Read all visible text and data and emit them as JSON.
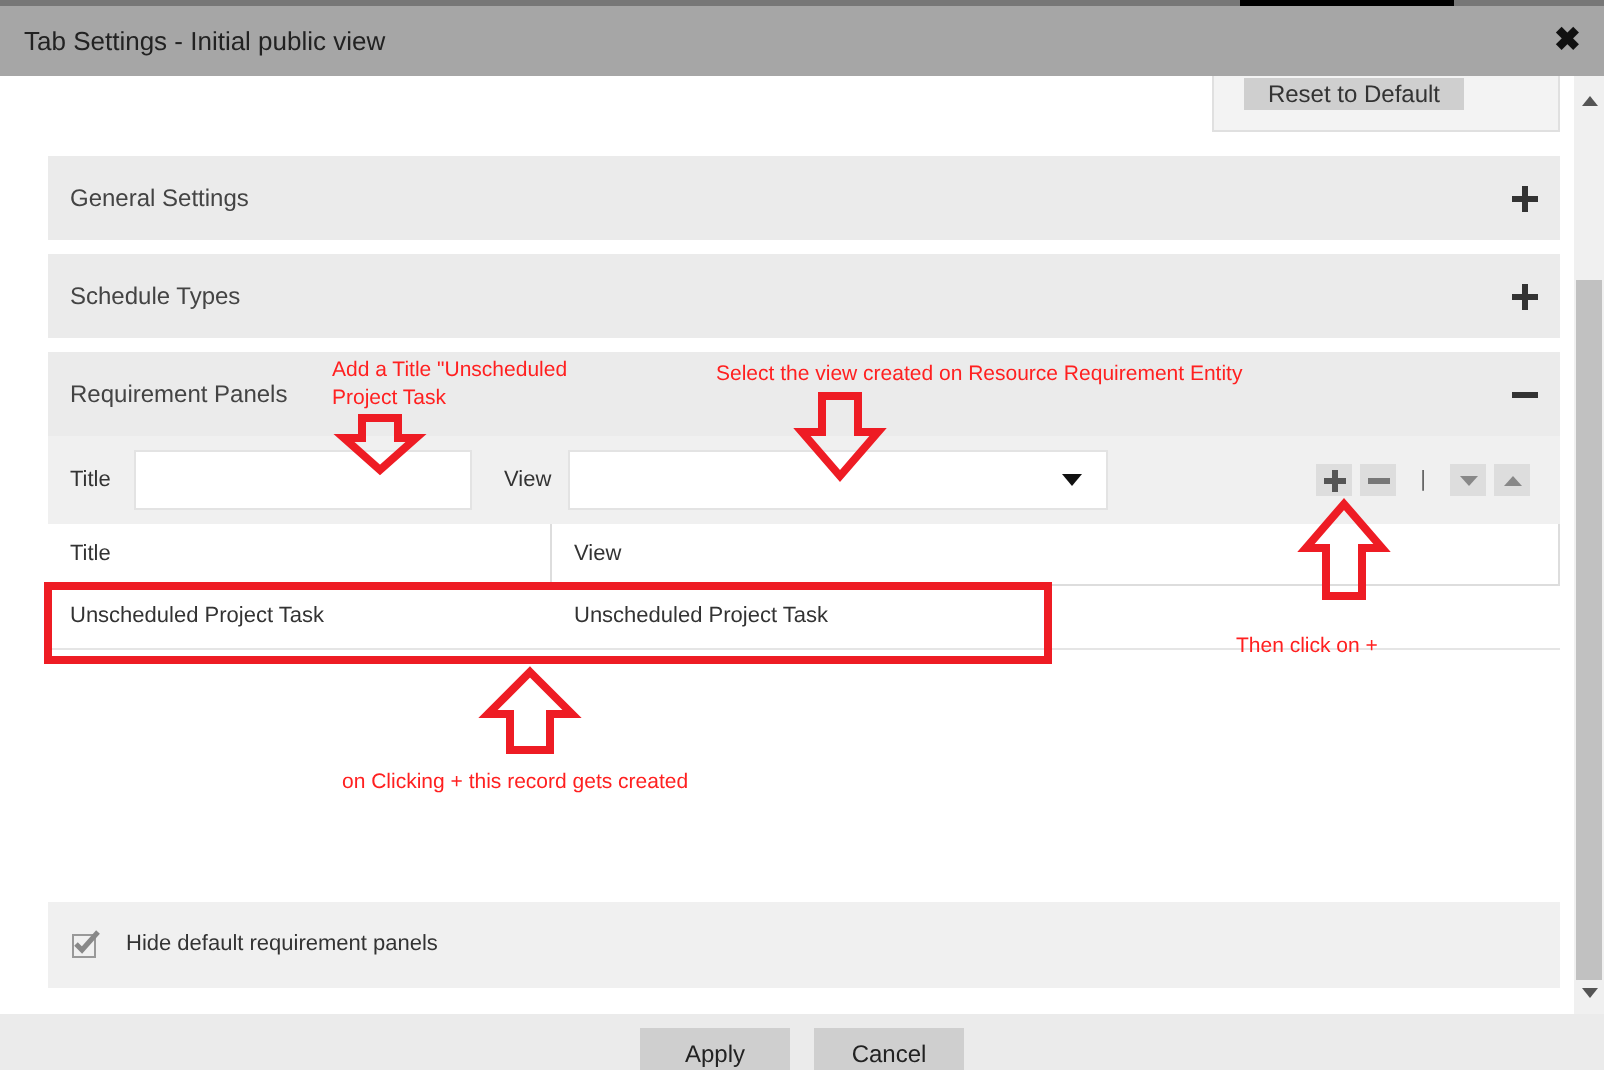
{
  "window": {
    "title": "Tab Settings - Initial public view",
    "close": "✖"
  },
  "reset_button": "Reset to Default",
  "sections": [
    {
      "title": "General Settings",
      "expanded": false
    },
    {
      "title": "Schedule Types",
      "expanded": false
    },
    {
      "title": "Requirement Panels",
      "expanded": true
    }
  ],
  "form": {
    "title_label": "Title",
    "view_label": "View",
    "separator": "|"
  },
  "table": {
    "columns": [
      "Title",
      "View"
    ],
    "rows": [
      [
        "Unscheduled Project Task",
        "Unscheduled Project Task"
      ]
    ]
  },
  "hide_default": {
    "label": "Hide default requirement panels",
    "checked": true
  },
  "buttons": [
    "Apply",
    "Cancel"
  ],
  "annotations": [
    {
      "text": "Add a Title \"Unscheduled Project Task"
    },
    {
      "text": "Select the view created on Resource Requirement Entity"
    },
    {
      "text": "Then click on +"
    },
    {
      "text": "on Clicking + this record gets created"
    }
  ]
}
